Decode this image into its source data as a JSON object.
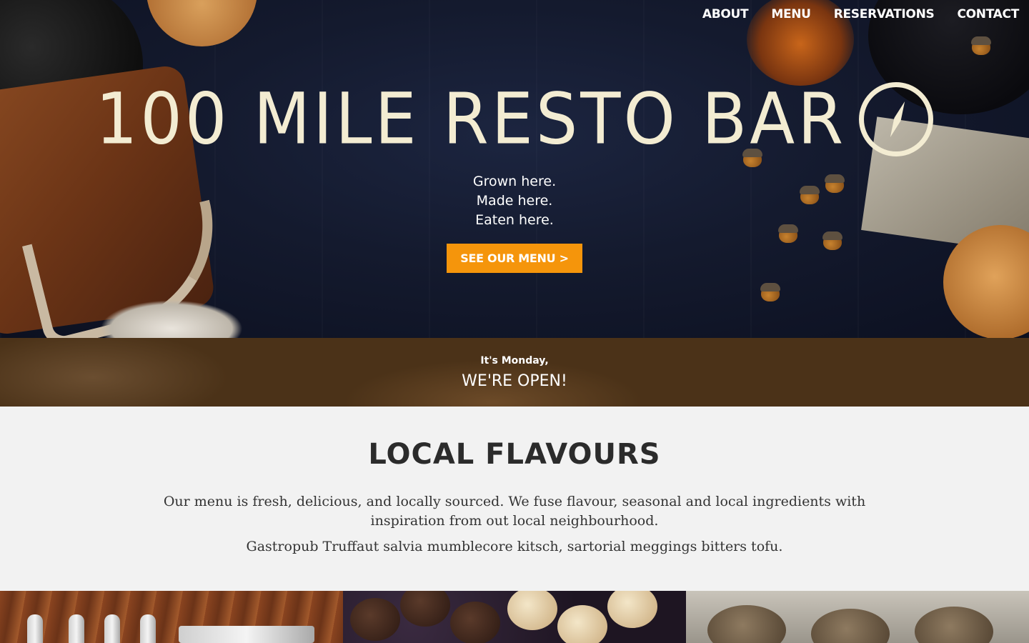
{
  "nav": {
    "items": [
      {
        "label": "ABOUT"
      },
      {
        "label": "MENU"
      },
      {
        "label": "RESERVATIONS"
      },
      {
        "label": "CONTACT"
      }
    ]
  },
  "hero": {
    "title": "100 MILE RESTO BAR",
    "logo_icon": "compass-icon",
    "tagline": [
      "Grown here.",
      "Made here.",
      "Eaten here."
    ],
    "cta_label": "SEE OUR MENU >"
  },
  "status": {
    "day_text": "It's Monday,",
    "open_text": "WE'RE OPEN!"
  },
  "flavours": {
    "heading": "LOCAL FLAVOURS",
    "paragraph1": "Our menu is fresh, delicious, and locally sourced. We fuse flavour, seasonal and local ingredients with inspiration from out local neighbourhood.",
    "paragraph2": "Gastropub Truffaut salvia mumblecore kitsch, sartorial meggings bitters tofu."
  },
  "photos": [
    {
      "subject": "cutlery-photo"
    },
    {
      "subject": "muffins-photo"
    },
    {
      "subject": "bread-photo"
    }
  ],
  "colors": {
    "cta_background": "#f5950b",
    "status_band": "#4b3218",
    "title_cream": "#f3ecd2",
    "section_background": "#f2f2f2"
  }
}
